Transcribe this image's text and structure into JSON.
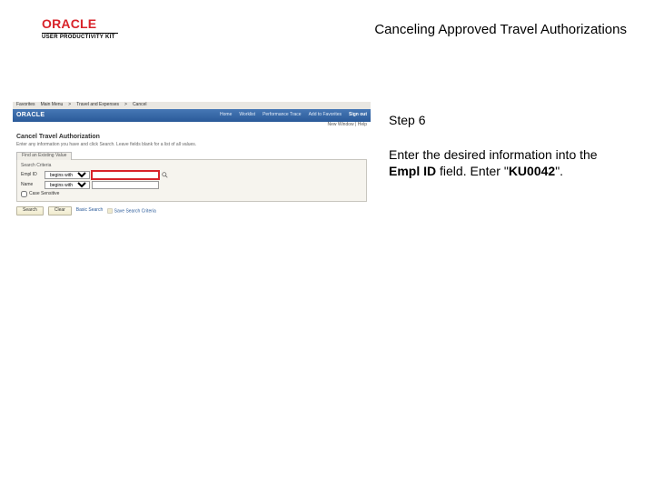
{
  "logo": {
    "brand": "ORACLE",
    "sub": "USER PRODUCTIVITY KIT"
  },
  "topic_title": "Canceling Approved Travel Authorizations",
  "instruction": {
    "step_label": "Step 6",
    "line1": "Enter the desired information into the ",
    "field_label": "Empl ID",
    "line2": " field. Enter \"",
    "value": "KU0042",
    "line3": "\"."
  },
  "shot": {
    "browser": {
      "favorites": "Favorites",
      "main_menu": "Main Menu",
      "path1": "Travel and Expenses",
      "path2": "Cancel"
    },
    "appbar": {
      "brand": "ORACLE",
      "home": "Home",
      "worklist": "Worklist",
      "perf": "Performance Trace",
      "addfav": "Add to Favorites",
      "signout": "Sign out"
    },
    "meta": "New Window | Help",
    "page_title": "Cancel Travel Authorization",
    "page_desc": "Enter any information you have and click Search. Leave fields blank for a list of all values.",
    "tab": "Find an Existing Value",
    "legend": "Search Criteria",
    "fields": {
      "empl_label": "Empl ID",
      "name_label": "Name",
      "op_begins": "begins with",
      "empl_value": "",
      "name_value": ""
    },
    "case_sensitive": "Case Sensitive",
    "buttons": {
      "search": "Search",
      "clear": "Clear",
      "basic": "Basic Search",
      "savecrit": "Save Search Criteria"
    }
  }
}
